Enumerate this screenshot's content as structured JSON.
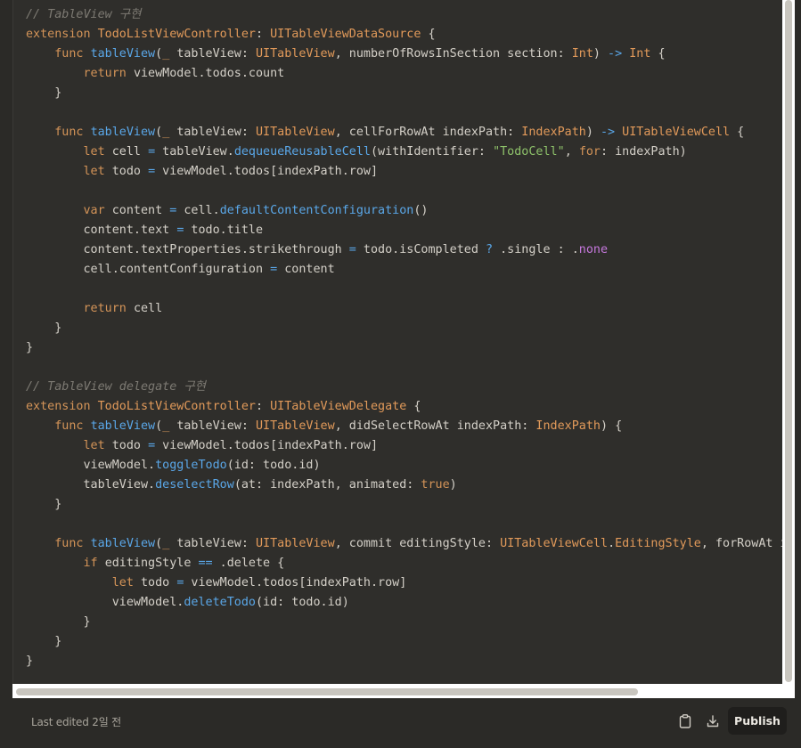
{
  "code": {
    "lines": [
      [
        {
          "t": "comment",
          "s": "// TableView 구현"
        }
      ],
      [
        {
          "t": "keyword",
          "s": "extension "
        },
        {
          "t": "type",
          "s": "TodoListViewController"
        },
        {
          "t": "plain",
          "s": ": "
        },
        {
          "t": "type",
          "s": "UITableViewDataSource"
        },
        {
          "t": "plain",
          "s": " {"
        }
      ],
      [
        {
          "t": "plain",
          "s": "    "
        },
        {
          "t": "keyword",
          "s": "func "
        },
        {
          "t": "func",
          "s": "tableView"
        },
        {
          "t": "plain",
          "s": "("
        },
        {
          "t": "keyword",
          "s": "_ "
        },
        {
          "t": "plain",
          "s": "tableView: "
        },
        {
          "t": "type",
          "s": "UITableView"
        },
        {
          "t": "plain",
          "s": ", numberOfRowsInSection section: "
        },
        {
          "t": "type",
          "s": "Int"
        },
        {
          "t": "plain",
          "s": ") "
        },
        {
          "t": "op",
          "s": "->"
        },
        {
          "t": "plain",
          "s": " "
        },
        {
          "t": "type",
          "s": "Int"
        },
        {
          "t": "plain",
          "s": " {"
        }
      ],
      [
        {
          "t": "plain",
          "s": "        "
        },
        {
          "t": "keyword",
          "s": "return "
        },
        {
          "t": "plain",
          "s": "viewModel.todos.count"
        }
      ],
      [
        {
          "t": "plain",
          "s": "    }"
        }
      ],
      [],
      [
        {
          "t": "plain",
          "s": "    "
        },
        {
          "t": "keyword",
          "s": "func "
        },
        {
          "t": "func",
          "s": "tableView"
        },
        {
          "t": "plain",
          "s": "("
        },
        {
          "t": "keyword",
          "s": "_ "
        },
        {
          "t": "plain",
          "s": "tableView: "
        },
        {
          "t": "type",
          "s": "UITableView"
        },
        {
          "t": "plain",
          "s": ", cellForRowAt indexPath: "
        },
        {
          "t": "type",
          "s": "IndexPath"
        },
        {
          "t": "plain",
          "s": ") "
        },
        {
          "t": "op",
          "s": "->"
        },
        {
          "t": "plain",
          "s": " "
        },
        {
          "t": "type",
          "s": "UITableViewCell"
        },
        {
          "t": "plain",
          "s": " {"
        }
      ],
      [
        {
          "t": "plain",
          "s": "        "
        },
        {
          "t": "keyword",
          "s": "let "
        },
        {
          "t": "plain",
          "s": "cell "
        },
        {
          "t": "op",
          "s": "="
        },
        {
          "t": "plain",
          "s": " tableView."
        },
        {
          "t": "func",
          "s": "dequeueReusableCell"
        },
        {
          "t": "plain",
          "s": "(withIdentifier: "
        },
        {
          "t": "string",
          "s": "\"TodoCell\""
        },
        {
          "t": "plain",
          "s": ", "
        },
        {
          "t": "keyword",
          "s": "for"
        },
        {
          "t": "plain",
          "s": ": indexPath)"
        }
      ],
      [
        {
          "t": "plain",
          "s": "        "
        },
        {
          "t": "keyword",
          "s": "let "
        },
        {
          "t": "plain",
          "s": "todo "
        },
        {
          "t": "op",
          "s": "="
        },
        {
          "t": "plain",
          "s": " viewModel.todos[indexPath.row]"
        }
      ],
      [],
      [
        {
          "t": "plain",
          "s": "        "
        },
        {
          "t": "keyword",
          "s": "var "
        },
        {
          "t": "plain",
          "s": "content "
        },
        {
          "t": "op",
          "s": "="
        },
        {
          "t": "plain",
          "s": " cell."
        },
        {
          "t": "func",
          "s": "defaultContentConfiguration"
        },
        {
          "t": "plain",
          "s": "()"
        }
      ],
      [
        {
          "t": "plain",
          "s": "        content.text "
        },
        {
          "t": "op",
          "s": "="
        },
        {
          "t": "plain",
          "s": " todo.title"
        }
      ],
      [
        {
          "t": "plain",
          "s": "        content.textProperties.strikethrough "
        },
        {
          "t": "op",
          "s": "="
        },
        {
          "t": "plain",
          "s": " todo.isCompleted "
        },
        {
          "t": "op",
          "s": "?"
        },
        {
          "t": "plain",
          "s": " .single : ."
        },
        {
          "t": "enum",
          "s": "none"
        }
      ],
      [
        {
          "t": "plain",
          "s": "        cell.contentConfiguration "
        },
        {
          "t": "op",
          "s": "="
        },
        {
          "t": "plain",
          "s": " content"
        }
      ],
      [],
      [
        {
          "t": "plain",
          "s": "        "
        },
        {
          "t": "keyword",
          "s": "return "
        },
        {
          "t": "plain",
          "s": "cell"
        }
      ],
      [
        {
          "t": "plain",
          "s": "    }"
        }
      ],
      [
        {
          "t": "plain",
          "s": "}"
        }
      ],
      [],
      [
        {
          "t": "comment",
          "s": "// TableView delegate 구현"
        }
      ],
      [
        {
          "t": "keyword",
          "s": "extension "
        },
        {
          "t": "type",
          "s": "TodoListViewController"
        },
        {
          "t": "plain",
          "s": ": "
        },
        {
          "t": "type",
          "s": "UITableViewDelegate"
        },
        {
          "t": "plain",
          "s": " {"
        }
      ],
      [
        {
          "t": "plain",
          "s": "    "
        },
        {
          "t": "keyword",
          "s": "func "
        },
        {
          "t": "func",
          "s": "tableView"
        },
        {
          "t": "plain",
          "s": "("
        },
        {
          "t": "keyword",
          "s": "_ "
        },
        {
          "t": "plain",
          "s": "tableView: "
        },
        {
          "t": "type",
          "s": "UITableView"
        },
        {
          "t": "plain",
          "s": ", didSelectRowAt indexPath: "
        },
        {
          "t": "type",
          "s": "IndexPath"
        },
        {
          "t": "plain",
          "s": ") {"
        }
      ],
      [
        {
          "t": "plain",
          "s": "        "
        },
        {
          "t": "keyword",
          "s": "let "
        },
        {
          "t": "plain",
          "s": "todo "
        },
        {
          "t": "op",
          "s": "="
        },
        {
          "t": "plain",
          "s": " viewModel.todos[indexPath.row]"
        }
      ],
      [
        {
          "t": "plain",
          "s": "        viewModel."
        },
        {
          "t": "func",
          "s": "toggleTodo"
        },
        {
          "t": "plain",
          "s": "(id: todo.id)"
        }
      ],
      [
        {
          "t": "plain",
          "s": "        tableView."
        },
        {
          "t": "func",
          "s": "deselectRow"
        },
        {
          "t": "plain",
          "s": "(at: indexPath, animated: "
        },
        {
          "t": "keyword",
          "s": "true"
        },
        {
          "t": "plain",
          "s": ")"
        }
      ],
      [
        {
          "t": "plain",
          "s": "    }"
        }
      ],
      [],
      [
        {
          "t": "plain",
          "s": "    "
        },
        {
          "t": "keyword",
          "s": "func "
        },
        {
          "t": "func",
          "s": "tableView"
        },
        {
          "t": "plain",
          "s": "("
        },
        {
          "t": "keyword",
          "s": "_ "
        },
        {
          "t": "plain",
          "s": "tableView: "
        },
        {
          "t": "type",
          "s": "UITableView"
        },
        {
          "t": "plain",
          "s": ", commit editingStyle: "
        },
        {
          "t": "type",
          "s": "UITableViewCell"
        },
        {
          "t": "plain",
          "s": "."
        },
        {
          "t": "type",
          "s": "EditingStyle"
        },
        {
          "t": "plain",
          "s": ", forRowAt i"
        }
      ],
      [
        {
          "t": "plain",
          "s": "        "
        },
        {
          "t": "keyword",
          "s": "if "
        },
        {
          "t": "plain",
          "s": "editingStyle "
        },
        {
          "t": "op",
          "s": "=="
        },
        {
          "t": "plain",
          "s": " .delete {"
        }
      ],
      [
        {
          "t": "plain",
          "s": "            "
        },
        {
          "t": "keyword",
          "s": "let "
        },
        {
          "t": "plain",
          "s": "todo "
        },
        {
          "t": "op",
          "s": "="
        },
        {
          "t": "plain",
          "s": " viewModel.todos[indexPath.row]"
        }
      ],
      [
        {
          "t": "plain",
          "s": "            viewModel."
        },
        {
          "t": "func",
          "s": "deleteTodo"
        },
        {
          "t": "plain",
          "s": "(id: todo.id)"
        }
      ],
      [
        {
          "t": "plain",
          "s": "        }"
        }
      ],
      [
        {
          "t": "plain",
          "s": "    }"
        }
      ],
      [
        {
          "t": "plain",
          "s": "}"
        }
      ]
    ]
  },
  "footer": {
    "last_edited": "Last edited 2일 전",
    "copy_icon": "clipboard-icon",
    "download_icon": "download-icon",
    "publish_label": "Publish"
  },
  "colors": {
    "background": "#2b2a27",
    "code_panel": "#2f2e2b",
    "keyword": "#d49458",
    "type": "#e29a5a",
    "function": "#5aa7e8",
    "string": "#8ec26a",
    "comment": "#7d7a73",
    "enum": "#c678dd"
  }
}
